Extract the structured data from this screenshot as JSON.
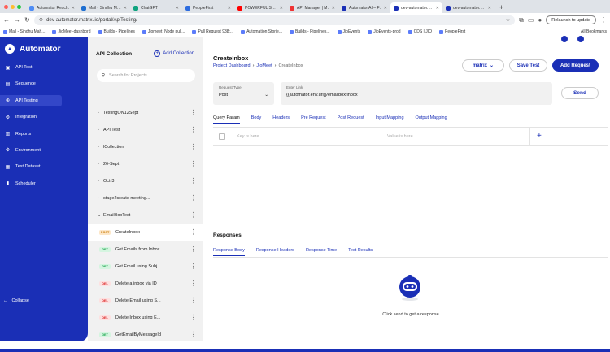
{
  "browser": {
    "tabs": [
      {
        "label": "Automator Resch…",
        "color": "#4f8df5"
      },
      {
        "label": "Mail - Sindhu M…",
        "color": "#1f6fd1"
      },
      {
        "label": "ChatGPT",
        "color": "#10a37f"
      },
      {
        "label": "PeopleFirst",
        "color": "#2d6cdf"
      },
      {
        "label": "POWERFUL S…",
        "color": "#ff0000"
      },
      {
        "label": "API Manager | M…",
        "color": "#e33"
      },
      {
        "label": "Automator.AI – F…",
        "color": "#1a2fb6"
      },
      {
        "label": "dev-automator.…",
        "color": "#1a2fb6"
      },
      {
        "label": "dev-automator.…",
        "color": "#1a2fb6"
      }
    ],
    "url": "dev-automator.matrix.jio/portal/ApiTesting/",
    "relaunch_label": "Relaunch to update",
    "bookmarks": [
      "Mail - Sindhu Mah...",
      "JioMeet-dashbord",
      "Builds - Pipelines",
      "Jiomeet_Node pull...",
      "Pull Request 938:...",
      "Automation Storie...",
      "Builds - Pipelines...",
      "JioEvents",
      "JioEvents-prod",
      "CDS | JIO",
      "PeopleFirst"
    ],
    "all_bookmarks": "All Bookmarks"
  },
  "sidebar": {
    "brand": "Automator",
    "items": [
      {
        "label": "API Test",
        "icon": "folder-icon"
      },
      {
        "label": "Sequence",
        "icon": "sequence-icon"
      },
      {
        "label": "API Testing",
        "icon": "api-testing-icon"
      },
      {
        "label": "Integration",
        "icon": "integration-icon"
      },
      {
        "label": "Reports",
        "icon": "reports-icon"
      },
      {
        "label": "Environment",
        "icon": "environment-icon"
      },
      {
        "label": "Test Dataset",
        "icon": "dataset-icon"
      },
      {
        "label": "Scheduler",
        "icon": "scheduler-icon"
      }
    ],
    "active_index": 2,
    "collapse": "Collapse"
  },
  "collection": {
    "title": "API Collection",
    "add_label": "Add Collection",
    "search_placeholder": "Search for Projects",
    "folders": [
      "TestingON12Sept",
      "API Test",
      "lCollection",
      "26-Sept",
      "Oct-3",
      "stage2create meeting...",
      "EmailBoxTest"
    ],
    "requests": [
      {
        "method": "POST",
        "name": "CreateInbox"
      },
      {
        "method": "GET",
        "name": "Get Emails from Inbox"
      },
      {
        "method": "GET",
        "name": "Get Email using Subj..."
      },
      {
        "method": "DEL",
        "name": "Delete a inbox via ID"
      },
      {
        "method": "DEL",
        "name": "Delete Email using S..."
      },
      {
        "method": "DEL",
        "name": "Delete Inbox using E..."
      },
      {
        "method": "GET",
        "name": "GetEmailByMessageId"
      }
    ]
  },
  "main": {
    "title": "CreateInbox",
    "breadcrumb": [
      "Project Dashboard",
      "JioMeet",
      "CreateInbox"
    ],
    "env_label": "matrix",
    "save_label": "Save Test",
    "add_request_label": "Add Request",
    "request_type_label": "Request Type",
    "request_type_value": "Post",
    "link_label": "Enter Link",
    "link_value": "{{automator.env.url}}/emailbox/inbox",
    "send_label": "Send",
    "tabs": [
      "Query Param",
      "Body",
      "Headers",
      "Pre Request",
      "Post Request",
      "Input Mapping",
      "Output Mapping"
    ],
    "key_placeholder": "Key is here",
    "value_placeholder": "Value is here",
    "responses_title": "Responses",
    "response_tabs": [
      "Response Body",
      "Response Headers",
      "Response Time",
      "Test Results"
    ],
    "hint": "Click send to get a response"
  },
  "colors": {
    "brand": "#1a2fb6"
  }
}
